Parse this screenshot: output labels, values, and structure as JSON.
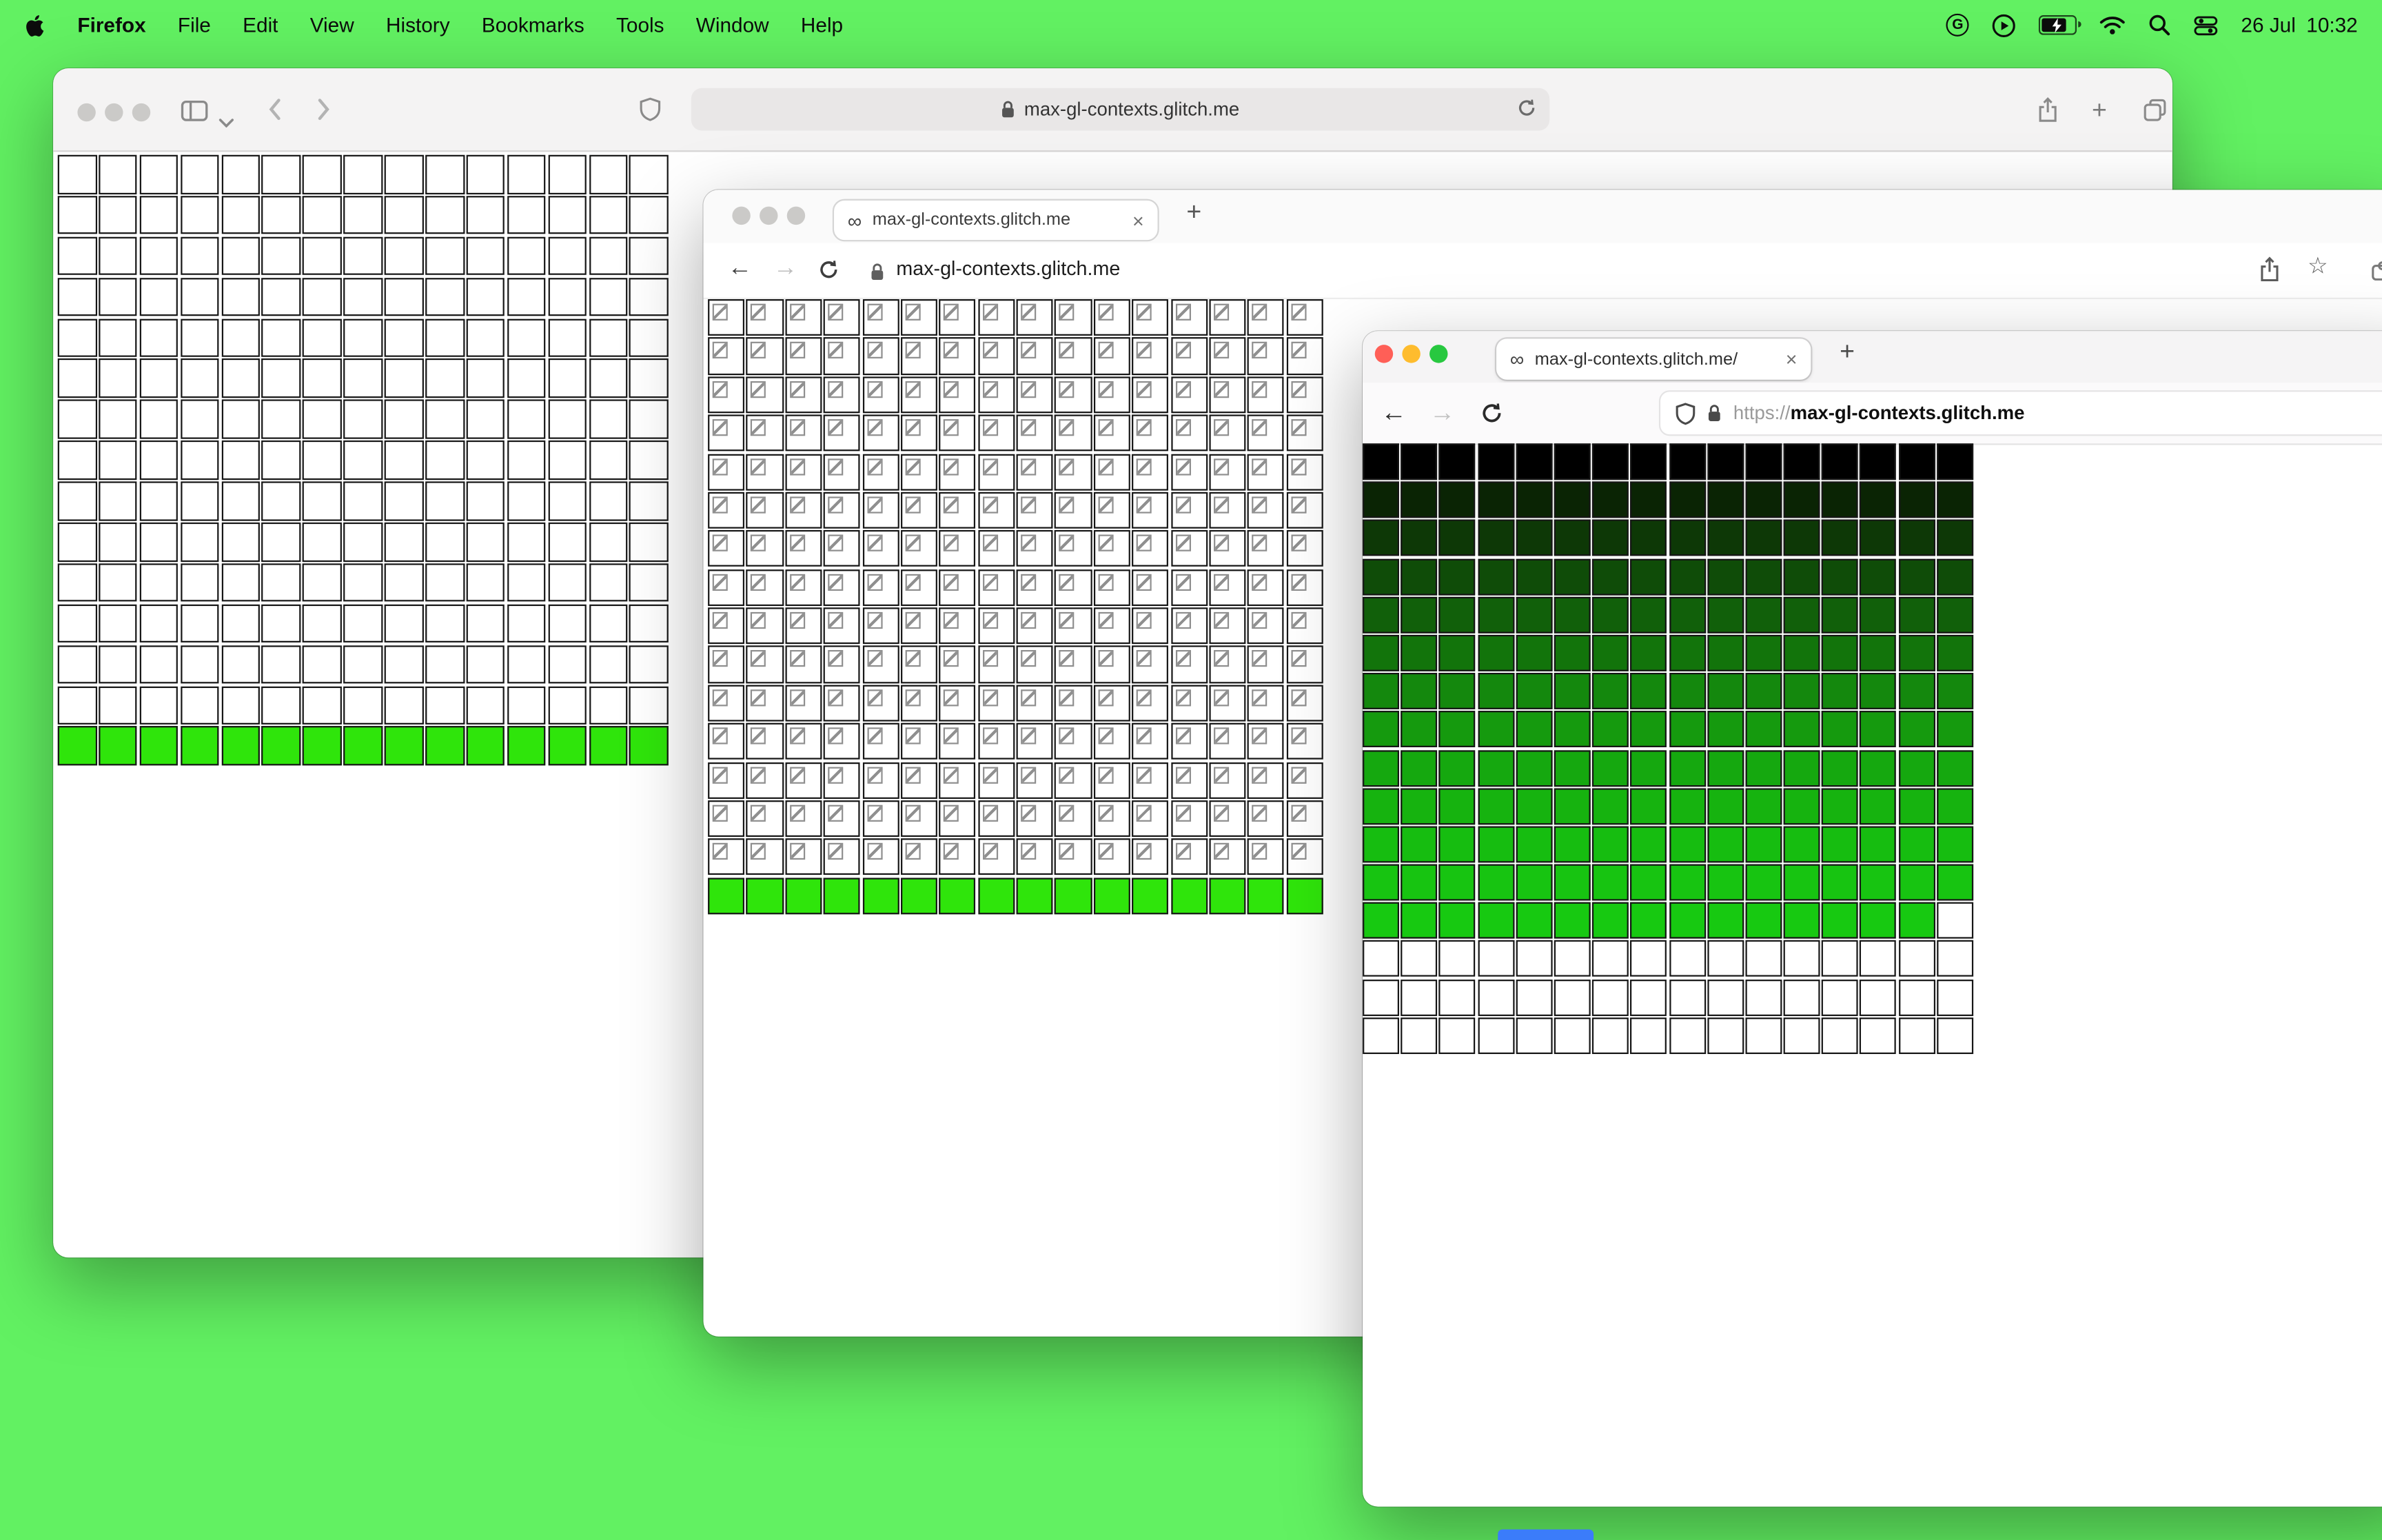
{
  "menubar": {
    "app_name": "Firefox",
    "menus": [
      "File",
      "Edit",
      "View",
      "History",
      "Bookmarks",
      "Tools",
      "Window",
      "Help"
    ],
    "status_date": "26 Jul",
    "status_time": "10:32"
  },
  "desktop": {
    "background": "#62f162",
    "dock_peek_color": "#3b7cfa"
  },
  "window_back": {
    "browser": "Safari",
    "url": "max-gl-contexts.glitch.me",
    "grid": {
      "cols": 15,
      "rows": [
        {
          "fill": "none",
          "count": 14
        },
        {
          "fill": "#2fe50b",
          "count": 1
        }
      ]
    }
  },
  "window_middle": {
    "tab_label": "max-gl-contexts.glitch.me",
    "tab_favicon": "∞",
    "url": "max-gl-contexts.glitch.me",
    "grid": {
      "cols": 16,
      "rows": [
        {
          "fill": "broken",
          "count": 15
        },
        {
          "fill": "#2fe50b",
          "count": 1
        }
      ]
    }
  },
  "window_front": {
    "browser": "Firefox",
    "tab_label": "max-gl-contexts.glitch.me/",
    "tab_favicon": "∞",
    "url_scheme": "https://",
    "url_host": "max-gl-contexts.glitch.me",
    "grid": {
      "cols": 16,
      "rows": [
        {
          "fill": "#000000"
        },
        {
          "fill": "#0a2404"
        },
        {
          "fill": "#0d3806"
        },
        {
          "fill": "#0f4c08"
        },
        {
          "fill": "#11600a"
        },
        {
          "fill": "#12740b"
        },
        {
          "fill": "#14880d"
        },
        {
          "fill": "#159a0e"
        },
        {
          "fill": "#15a80f"
        },
        {
          "fill": "#16b30f"
        },
        {
          "fill": "#16bd10"
        },
        {
          "fill": "#17c411"
        },
        {
          "fill": "#17c911",
          "last_empty": true
        },
        {
          "fill": "none",
          "count": 3
        }
      ]
    }
  },
  "glyphs": {
    "plus": "+",
    "close": "×",
    "back_arrow": "←",
    "forward_arrow": "→",
    "star": "☆"
  }
}
